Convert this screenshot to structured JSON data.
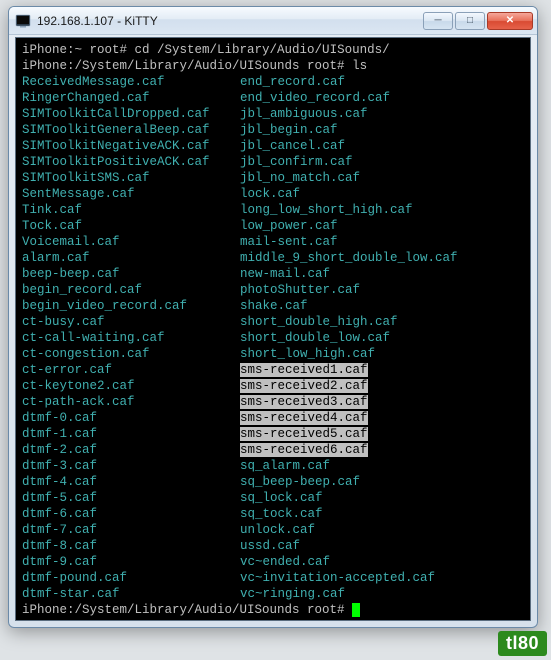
{
  "titlebar": {
    "title": "192.168.1.107 - KiTTY",
    "min_label": "─",
    "max_label": "□",
    "close_label": "✕"
  },
  "terminal": {
    "prompt1_path": "iPhone:~ root# ",
    "cmd1": "cd /System/Library/Audio/UISounds/",
    "prompt2_path": "iPhone:/System/Library/Audio/UISounds root# ",
    "cmd2": "ls",
    "prompt3_path": "iPhone:/System/Library/Audio/UISounds root# ",
    "files_left": [
      "ReceivedMessage.caf",
      "RingerChanged.caf",
      "SIMToolkitCallDropped.caf",
      "SIMToolkitGeneralBeep.caf",
      "SIMToolkitNegativeACK.caf",
      "SIMToolkitPositiveACK.caf",
      "SIMToolkitSMS.caf",
      "SentMessage.caf",
      "Tink.caf",
      "Tock.caf",
      "Voicemail.caf",
      "alarm.caf",
      "beep-beep.caf",
      "begin_record.caf",
      "begin_video_record.caf",
      "ct-busy.caf",
      "ct-call-waiting.caf",
      "ct-congestion.caf",
      "ct-error.caf",
      "ct-keytone2.caf",
      "ct-path-ack.caf",
      "dtmf-0.caf",
      "dtmf-1.caf",
      "dtmf-2.caf",
      "dtmf-3.caf",
      "dtmf-4.caf",
      "dtmf-5.caf",
      "dtmf-6.caf",
      "dtmf-7.caf",
      "dtmf-8.caf",
      "dtmf-9.caf",
      "dtmf-pound.caf",
      "dtmf-star.caf"
    ],
    "files_right": [
      "end_record.caf",
      "end_video_record.caf",
      "jbl_ambiguous.caf",
      "jbl_begin.caf",
      "jbl_cancel.caf",
      "jbl_confirm.caf",
      "jbl_no_match.caf",
      "lock.caf",
      "long_low_short_high.caf",
      "low_power.caf",
      "mail-sent.caf",
      "middle_9_short_double_low.caf",
      "new-mail.caf",
      "photoShutter.caf",
      "shake.caf",
      "short_double_high.caf",
      "short_double_low.caf",
      "short_low_high.caf",
      "sms-received1.caf",
      "sms-received2.caf",
      "sms-received3.caf",
      "sms-received4.caf",
      "sms-received5.caf",
      "sms-received6.caf",
      "sq_alarm.caf",
      "sq_beep-beep.caf",
      "sq_lock.caf",
      "sq_tock.caf",
      "unlock.caf",
      "ussd.caf",
      "vc~ended.caf",
      "vc~invitation-accepted.caf",
      "vc~ringing.caf"
    ],
    "highlighted_right_indices": [
      18,
      19,
      20,
      21,
      22,
      23
    ]
  },
  "badge_text": "tl80"
}
